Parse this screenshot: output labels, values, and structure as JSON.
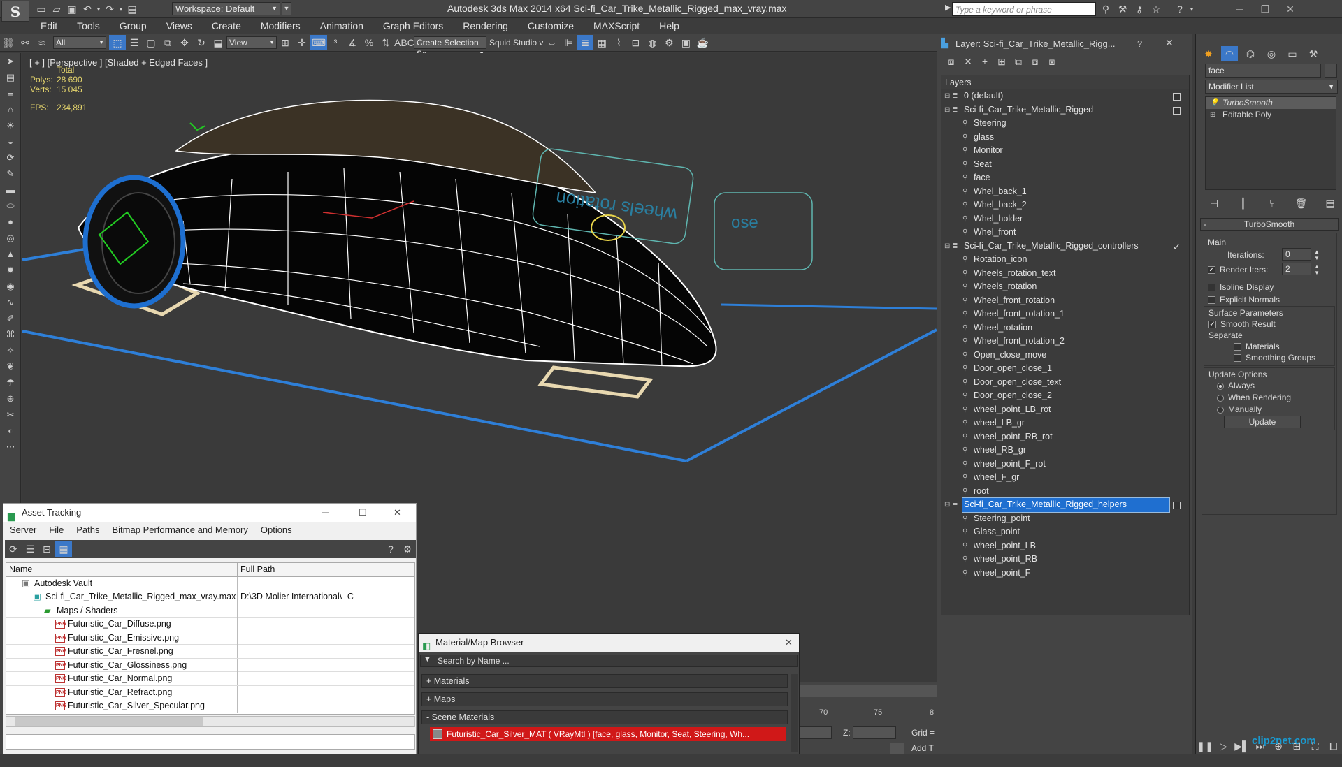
{
  "titlebar": {
    "workspace": "Workspace: Default",
    "title": "Autodesk 3ds Max  2014 x64     Sci-fi_Car_Trike_Metallic_Rigged_max_vray.max",
    "search_placeholder": "Type a keyword or phrase"
  },
  "menu": [
    "Edit",
    "Tools",
    "Group",
    "Views",
    "Create",
    "Modifiers",
    "Animation",
    "Graph Editors",
    "Rendering",
    "Customize",
    "MAXScript",
    "Help"
  ],
  "toolbar": {
    "filter": "All",
    "ref_coord": "View",
    "named_selection": "Create Selection Se",
    "squid": "Squid Studio v"
  },
  "viewport": {
    "label": "[ + ] [Perspective ] [Shaded + Edged Faces ]",
    "stats_total": "Total",
    "polys_label": "Polys:",
    "polys_value": "28 690",
    "verts_label": "Verts:",
    "verts_value": "15 045",
    "fps_label": "FPS:",
    "fps_value": "234,891",
    "gizmo_text_1": "wheels rotation",
    "gizmo_text_2": "ose",
    "colors": {
      "wire": "#ffffff",
      "body": "#050505",
      "grid_blue": "#2e7fd8",
      "wheel_blue": "#1e6fd0",
      "selection_green": "#22cc22",
      "shadow_beige": "#e8d8b0",
      "helper_cyan": "#5fb6b0",
      "yellow": "#e8d44a"
    }
  },
  "layer_panel": {
    "title": "Layer: Sci-fi_Car_Trike_Metallic_Rigg...",
    "help": "?",
    "column": "Layers",
    "rows": [
      {
        "label": "0 (default)",
        "level": 0,
        "type": "layer",
        "box": true
      },
      {
        "label": "Sci-fi_Car_Trike_Metallic_Rigged",
        "level": 0,
        "type": "layer",
        "box": true
      },
      {
        "label": "Steering",
        "level": 1,
        "type": "obj"
      },
      {
        "label": "glass",
        "level": 1,
        "type": "obj"
      },
      {
        "label": "Monitor",
        "level": 1,
        "type": "obj"
      },
      {
        "label": "Seat",
        "level": 1,
        "type": "obj"
      },
      {
        "label": "face",
        "level": 1,
        "type": "obj"
      },
      {
        "label": "Whel_back_1",
        "level": 1,
        "type": "obj"
      },
      {
        "label": "Whel_back_2",
        "level": 1,
        "type": "obj"
      },
      {
        "label": "Whel_holder",
        "level": 1,
        "type": "obj"
      },
      {
        "label": "Whel_front",
        "level": 1,
        "type": "obj"
      },
      {
        "label": "Sci-fi_Car_Trike_Metallic_Rigged_controllers",
        "level": 0,
        "type": "layer",
        "check": true
      },
      {
        "label": "Rotation_icon",
        "level": 1,
        "type": "obj"
      },
      {
        "label": "Wheels_rotation_text",
        "level": 1,
        "type": "obj"
      },
      {
        "label": "Wheels_rotation",
        "level": 1,
        "type": "obj"
      },
      {
        "label": "Wheel_front_rotation",
        "level": 1,
        "type": "obj"
      },
      {
        "label": "Wheel_front_rotation_1",
        "level": 1,
        "type": "obj"
      },
      {
        "label": "Wheel_rotation",
        "level": 1,
        "type": "obj"
      },
      {
        "label": "Wheel_front_rotation_2",
        "level": 1,
        "type": "obj"
      },
      {
        "label": "Open_close_move",
        "level": 1,
        "type": "obj"
      },
      {
        "label": "Door_open_close_1",
        "level": 1,
        "type": "obj"
      },
      {
        "label": "Door_open_close_text",
        "level": 1,
        "type": "obj"
      },
      {
        "label": "Door_open_close_2",
        "level": 1,
        "type": "obj"
      },
      {
        "label": "wheel_point_LB_rot",
        "level": 1,
        "type": "obj"
      },
      {
        "label": "wheel_LB_gr",
        "level": 1,
        "type": "obj"
      },
      {
        "label": "wheel_point_RB_rot",
        "level": 1,
        "type": "obj"
      },
      {
        "label": "wheel_RB_gr",
        "level": 1,
        "type": "obj"
      },
      {
        "label": "wheel_point_F_rot",
        "level": 1,
        "type": "obj"
      },
      {
        "label": "wheel_F_gr",
        "level": 1,
        "type": "obj"
      },
      {
        "label": "root",
        "level": 1,
        "type": "obj"
      },
      {
        "label": "Sci-fi_Car_Trike_Metallic_Rigged_helpers",
        "level": 0,
        "type": "layer",
        "box": true,
        "selected": true
      },
      {
        "label": "Steering_point",
        "level": 1,
        "type": "obj"
      },
      {
        "label": "Glass_point",
        "level": 1,
        "type": "obj"
      },
      {
        "label": "wheel_point_LB",
        "level": 1,
        "type": "obj"
      },
      {
        "label": "wheel_point_RB",
        "level": 1,
        "type": "obj"
      },
      {
        "label": "wheel_point_F",
        "level": 1,
        "type": "obj"
      }
    ]
  },
  "command_panel": {
    "object_name": "face",
    "modifier_list": "Modifier List",
    "stack": [
      "TurboSmooth",
      "Editable Poly"
    ],
    "rollout": "TurboSmooth",
    "main": "Main",
    "iterations_label": "Iterations:",
    "iterations_value": "0",
    "render_iters_label": "Render Iters:",
    "render_iters_value": "2",
    "isoline": "Isoline Display",
    "explicit_normals": "Explicit Normals",
    "surface_params": "Surface Parameters",
    "smooth_result": "Smooth Result",
    "separate": "Separate",
    "materials": "Materials",
    "smoothing_groups": "Smoothing Groups",
    "update_options": "Update Options",
    "always": "Always",
    "when_rendering": "When Rendering",
    "manually": "Manually",
    "update_btn": "Update"
  },
  "asset_tracking": {
    "title": "Asset Tracking",
    "menu": [
      "Server",
      "File",
      "Paths",
      "Bitmap Performance and Memory",
      "Options"
    ],
    "col_name": "Name",
    "col_path": "Full Path",
    "rows": [
      {
        "name": "Autodesk Vault",
        "level": 0,
        "path": ""
      },
      {
        "name": "Sci-fi_Car_Trike_Metallic_Rigged_max_vray.max",
        "level": 1,
        "path": "D:\\3D Molier International\\- C"
      },
      {
        "name": "Maps / Shaders",
        "level": 2,
        "path": ""
      },
      {
        "name": "Futuristic_Car_Diffuse.png",
        "level": 3,
        "path": ""
      },
      {
        "name": "Futuristic_Car_Emissive.png",
        "level": 3,
        "path": ""
      },
      {
        "name": "Futuristic_Car_Fresnel.png",
        "level": 3,
        "path": ""
      },
      {
        "name": "Futuristic_Car_Glossiness.png",
        "level": 3,
        "path": ""
      },
      {
        "name": "Futuristic_Car_Normal.png",
        "level": 3,
        "path": ""
      },
      {
        "name": "Futuristic_Car_Refract.png",
        "level": 3,
        "path": ""
      },
      {
        "name": "Futuristic_Car_Silver_Specular.png",
        "level": 3,
        "path": ""
      }
    ]
  },
  "material_browser": {
    "title": "Material/Map Browser",
    "search": "Search by Name ...",
    "groups": [
      "+ Materials",
      "+ Maps",
      "- Scene Materials"
    ],
    "material_item": "Futuristic_Car_Silver_MAT  ( VRayMtl )  [face, glass, Monitor, Seat, Steering, Wh..."
  },
  "timeline": {
    "ticks": [
      "70",
      "75",
      "8"
    ],
    "z_label": "Z:",
    "grid": "Grid =",
    "add": "Add T"
  },
  "watermark": "clip2net.com"
}
